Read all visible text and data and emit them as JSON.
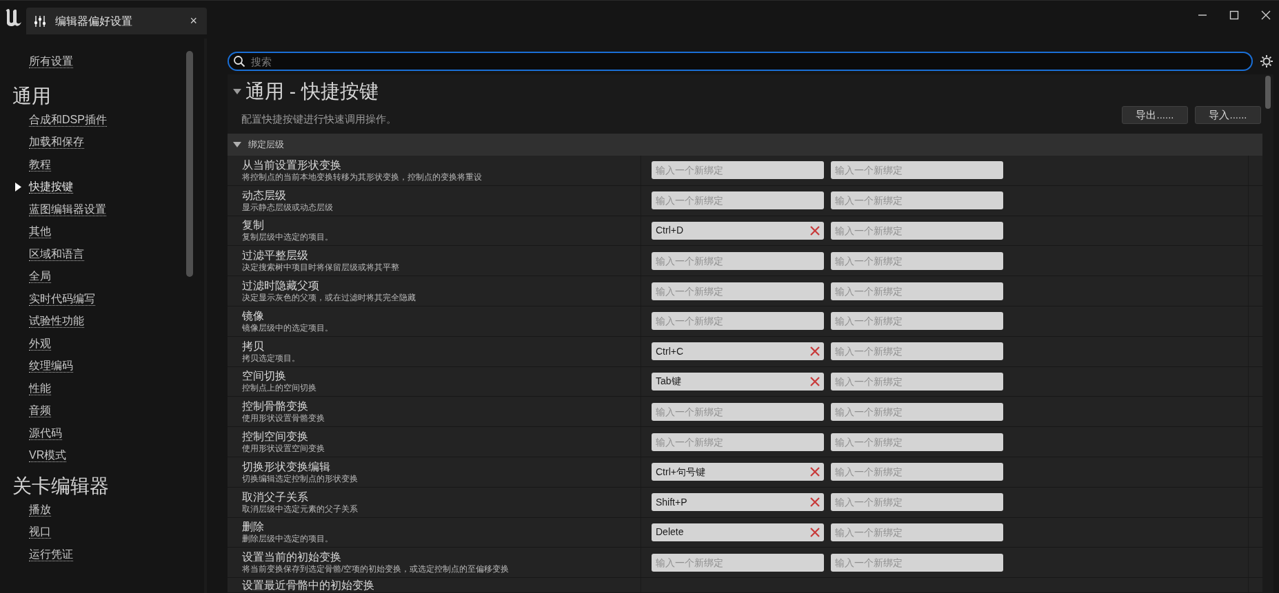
{
  "tab": {
    "title": "编辑器偏好设置",
    "close": "×"
  },
  "sidebar": {
    "items": [
      {
        "kind": "link",
        "label": "所有设置",
        "selected": false
      },
      {
        "kind": "heading",
        "label": "通用"
      },
      {
        "kind": "link",
        "label": "合成和DSP插件",
        "selected": false
      },
      {
        "kind": "link",
        "label": "加载和保存",
        "selected": false
      },
      {
        "kind": "link",
        "label": "教程",
        "selected": false
      },
      {
        "kind": "link",
        "label": "快捷按键",
        "selected": true
      },
      {
        "kind": "link",
        "label": "蓝图编辑器设置",
        "selected": false
      },
      {
        "kind": "link",
        "label": "其他",
        "selected": false
      },
      {
        "kind": "link",
        "label": "区域和语言",
        "selected": false
      },
      {
        "kind": "link",
        "label": "全局",
        "selected": false
      },
      {
        "kind": "link",
        "label": "实时代码编写",
        "selected": false
      },
      {
        "kind": "link",
        "label": "试验性功能",
        "selected": false
      },
      {
        "kind": "link",
        "label": "外观",
        "selected": false
      },
      {
        "kind": "link",
        "label": "纹理编码",
        "selected": false
      },
      {
        "kind": "link",
        "label": "性能",
        "selected": false
      },
      {
        "kind": "link",
        "label": "音频",
        "selected": false
      },
      {
        "kind": "link",
        "label": "源代码",
        "selected": false
      },
      {
        "kind": "link",
        "label": "VR模式",
        "selected": false
      },
      {
        "kind": "heading",
        "label": "关卡编辑器"
      },
      {
        "kind": "link",
        "label": "播放",
        "selected": false
      },
      {
        "kind": "link",
        "label": "视口",
        "selected": false
      },
      {
        "kind": "link",
        "label": "运行凭证",
        "selected": false
      }
    ]
  },
  "search": {
    "placeholder": "搜索"
  },
  "page": {
    "title": "通用 - 快捷按键",
    "subtitle": "配置快捷按键进行快速调用操作。",
    "buttons": [
      "导出......",
      "导入......"
    ]
  },
  "section": {
    "title": "绑定层级",
    "expanded": true,
    "rows": [
      {
        "name": "从当前设置形状变换",
        "desc": "将控制点的当前本地变换转移为其形状变换，控制点的变换将重设",
        "bindings": [
          {
            "placeholder": "输入一个新绑定"
          },
          {
            "placeholder": "输入一个新绑定"
          }
        ]
      },
      {
        "name": "动态层级",
        "desc": "显示静态层级或动态层级",
        "bindings": [
          {
            "placeholder": "输入一个新绑定"
          },
          {
            "placeholder": "输入一个新绑定"
          }
        ]
      },
      {
        "name": "复制",
        "desc": "复制层级中选定的项目。",
        "bindings": [
          {
            "value": "Ctrl+D"
          },
          {
            "placeholder": "输入一个新绑定"
          }
        ]
      },
      {
        "name": "过滤平整层级",
        "desc": "决定搜索树中项目时将保留层级或将其平整",
        "bindings": [
          {
            "placeholder": "输入一个新绑定"
          },
          {
            "placeholder": "输入一个新绑定"
          }
        ]
      },
      {
        "name": "过滤时隐藏父项",
        "desc": "决定显示灰色的父项，或在过滤时将其完全隐藏",
        "bindings": [
          {
            "placeholder": "输入一个新绑定"
          },
          {
            "placeholder": "输入一个新绑定"
          }
        ]
      },
      {
        "name": "镜像",
        "desc": "镜像层级中的选定项目。",
        "bindings": [
          {
            "placeholder": "输入一个新绑定"
          },
          {
            "placeholder": "输入一个新绑定"
          }
        ]
      },
      {
        "name": "拷贝",
        "desc": "拷贝选定项目。",
        "bindings": [
          {
            "value": "Ctrl+C"
          },
          {
            "placeholder": "输入一个新绑定"
          }
        ]
      },
      {
        "name": "空间切换",
        "desc": "控制点上的空间切换",
        "bindings": [
          {
            "value": "Tab键"
          },
          {
            "placeholder": "输入一个新绑定"
          }
        ]
      },
      {
        "name": "控制骨骼变换",
        "desc": "使用形状设置骨骼变换",
        "bindings": [
          {
            "placeholder": "输入一个新绑定"
          },
          {
            "placeholder": "输入一个新绑定"
          }
        ]
      },
      {
        "name": "控制空间变换",
        "desc": "使用形状设置空间变换",
        "bindings": [
          {
            "placeholder": "输入一个新绑定"
          },
          {
            "placeholder": "输入一个新绑定"
          }
        ]
      },
      {
        "name": "切换形状变换编辑",
        "desc": "切换编辑选定控制点的形状变换",
        "bindings": [
          {
            "value": "Ctrl+句号键"
          },
          {
            "placeholder": "输入一个新绑定"
          }
        ]
      },
      {
        "name": "取消父子关系",
        "desc": "取消层级中选定元素的父子关系",
        "bindings": [
          {
            "value": "Shift+P"
          },
          {
            "placeholder": "输入一个新绑定"
          }
        ]
      },
      {
        "name": "删除",
        "desc": "删除层级中选定的项目。",
        "bindings": [
          {
            "value": "Delete"
          },
          {
            "placeholder": "输入一个新绑定"
          }
        ]
      },
      {
        "name": "设置当前的初始变换",
        "desc": "将当前变换保存到选定骨骼/空项的初始变换，或选定控制点的至偏移变换",
        "bindings": [
          {
            "placeholder": "输入一个新绑定"
          },
          {
            "placeholder": "输入一个新绑定"
          }
        ]
      },
      {
        "name": "设置最近骨骼中的初始变换"
      }
    ]
  }
}
